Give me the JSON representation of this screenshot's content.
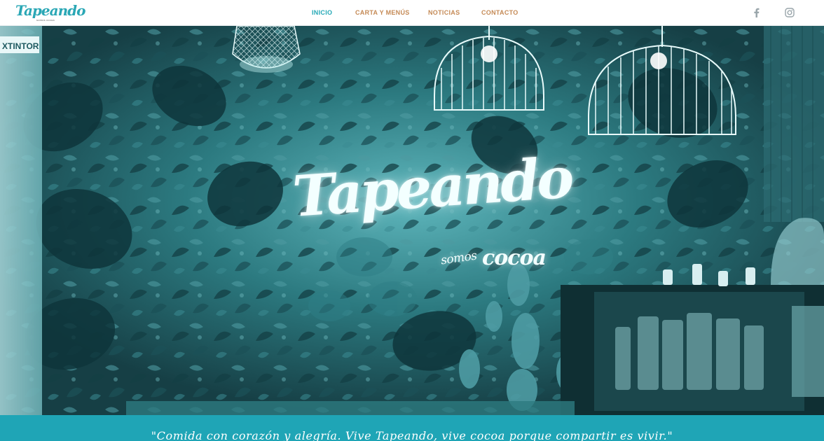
{
  "brand": {
    "logo_text": "Tapeando",
    "logo_subtext": "somos cocoa"
  },
  "nav": {
    "items": [
      {
        "label": "INICIO",
        "active": true
      },
      {
        "label": "CARTA Y MENÚS",
        "active": false
      },
      {
        "label": "NOTICIAS",
        "active": false
      },
      {
        "label": "CONTACTO",
        "active": false
      }
    ]
  },
  "social": {
    "facebook_icon": "facebook-icon",
    "instagram_icon": "instagram-icon"
  },
  "hero": {
    "title": "Tapeando",
    "subtitle_small": "somos",
    "subtitle_big": "cocoa",
    "sign_text": "XTINTOR"
  },
  "banner": {
    "quote": "\"Comida con corazón y alegría. Vive Tapeando, vive cocoa porque compartir es vivir.\""
  },
  "colors": {
    "accent": "#25a8b6",
    "nav_text": "#c58a56",
    "banner_bg": "#1fa5b6",
    "hero_tint": "#1c5f66"
  }
}
